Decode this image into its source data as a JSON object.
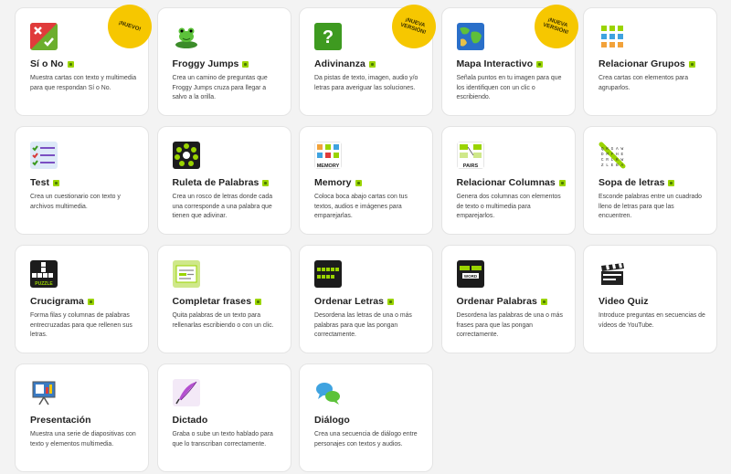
{
  "cards": [
    {
      "title": "Sí o No",
      "desc": "Muestra cartas con texto y multimedia para que respondan Sí o No.",
      "badge": "¡NUEVO!",
      "icon": "yes-no-icon"
    },
    {
      "title": "Froggy Jumps",
      "desc": "Crea un camino de preguntas que Froggy Jumps cruza para llegar a salvo a la orilla.",
      "badge": "",
      "icon": "frog-icon"
    },
    {
      "title": "Adivinanza",
      "desc": "Da pistas de texto, imagen, audio y/o letras para averiguar las soluciones.",
      "badge": "¡NUEVA VERSIÓN!",
      "icon": "question-mark-icon"
    },
    {
      "title": "Mapa Interactivo",
      "desc": "Señala puntos en tu imagen para que los identifiquen con un clic o escribiendo.",
      "badge": "¡NUEVA VERSIÓN!",
      "icon": "map-icon"
    },
    {
      "title": "Relacionar Grupos",
      "desc": "Crea cartas con elementos para agruparlos.",
      "badge": "",
      "icon": "group-grid-icon"
    },
    {
      "title": "Test",
      "desc": "Crea un cuestionario con texto y archivos multimedia.",
      "badge": "",
      "icon": "checklist-icon"
    },
    {
      "title": "Ruleta de Palabras",
      "desc": "Crea un rosco de letras donde cada una corresponde a una palabra que tienen que adivinar.",
      "badge": "",
      "icon": "letter-wheel-icon"
    },
    {
      "title": "Memory",
      "desc": "Coloca boca abajo cartas con tus textos, audios e imágenes para emparejarlas.",
      "badge": "",
      "icon": "memory-cards-icon"
    },
    {
      "title": "Relacionar Columnas",
      "desc": "Genera dos columnas con elementos de texto o multimedia para emparejarlos.",
      "badge": "",
      "icon": "pairs-icon"
    },
    {
      "title": "Sopa de letras",
      "desc": "Esconde palabras entre un cuadrado lleno de letras para que las encuentren.",
      "badge": "",
      "icon": "word-search-icon"
    },
    {
      "title": "Crucigrama",
      "desc": "Forma filas y columnas de palabras entrecruzadas para que rellenen sus letras.",
      "badge": "",
      "icon": "crossword-icon"
    },
    {
      "title": "Completar frases",
      "desc": "Quita palabras de un texto para rellenarlas escribiendo o con un clic.",
      "badge": "",
      "icon": "fill-blanks-icon"
    },
    {
      "title": "Ordenar Letras",
      "desc": "Desordena las letras de una o más palabras para que las pongan correctamente.",
      "badge": "",
      "icon": "letter-order-icon"
    },
    {
      "title": "Ordenar Palabras",
      "desc": "Desordena las palabras de una o más frases para que las pongan correctamente.",
      "badge": "",
      "icon": "word-order-icon"
    },
    {
      "title": "Video Quiz",
      "desc": "Introduce preguntas en secuencias de vídeos de YouTube.",
      "badge": "",
      "icon": "clapperboard-icon"
    },
    {
      "title": "Presentación",
      "desc": "Muestra una serie de diapositivas con texto y elementos multimedia.",
      "badge": "",
      "icon": "presentation-icon"
    },
    {
      "title": "Dictado",
      "desc": "Graba o sube un texto hablado para que lo transcriban correctamente.",
      "badge": "",
      "icon": "quill-pen-icon"
    },
    {
      "title": "Diálogo",
      "desc": "Crea una secuencia de diálogo entre personajes con textos y audios.",
      "badge": "",
      "icon": "speech-bubbles-icon"
    }
  ],
  "icon_labels": {
    "memory": "MEMORY",
    "pairs": "PAIRS",
    "word_search_letters": "Q K G A W D M F H E C R L K W T M I C U N N K E X N L G A A Z L E B A",
    "crossword_label": "PUZZLE",
    "word_order_label": "WORD"
  },
  "colors": {
    "accent_tag": "#9ad400",
    "badge": "#f6c700",
    "card_bg": "#ffffff",
    "page_bg": "#f3f3f3"
  }
}
